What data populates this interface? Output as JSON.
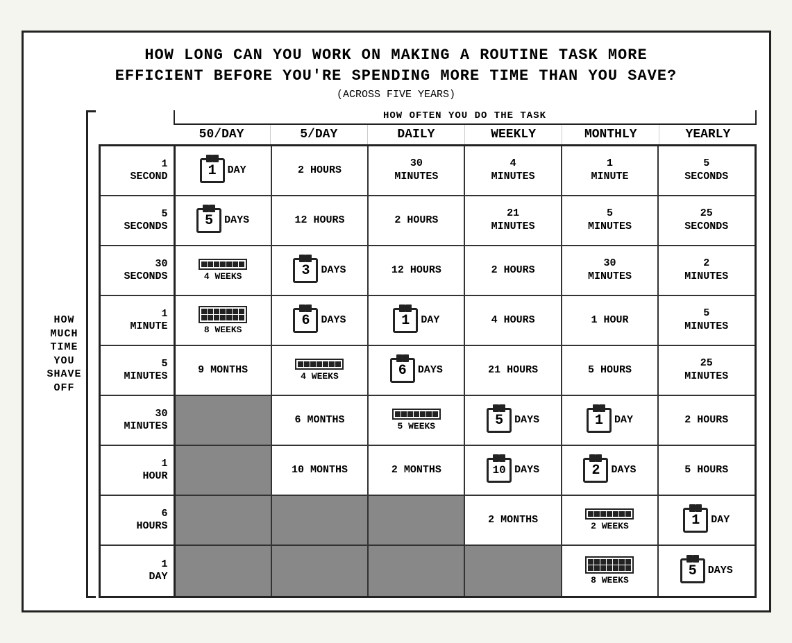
{
  "title": {
    "line1": "HOW LONG CAN YOU WORK ON MAKING A ROUTINE TASK MORE",
    "line2": "EFFICIENT BEFORE YOU'RE SPENDING MORE TIME THAN YOU SAVE?",
    "subtitle": "(ACROSS FIVE YEARS)"
  },
  "how_often_label": "HOW OFTEN YOU DO THE TASK",
  "col_labels": [
    "50/DAY",
    "5/DAY",
    "DAILY",
    "WEEKLY",
    "MONTHLY",
    "YEARLY"
  ],
  "left_label": {
    "line1": "HOW",
    "line2": "MUCH",
    "line3": "TIME",
    "line4": "YOU",
    "line5": "SHAVE",
    "line6": "OFF"
  },
  "row_headers": [
    "1 SECOND",
    "5 SECONDS",
    "30 SECONDS",
    "1 MINUTE",
    "5 MINUTES",
    "30 MINUTES",
    "1 HOUR",
    "6 HOURS",
    "1 DAY"
  ],
  "grid": [
    [
      {
        "type": "cal1",
        "val": "1",
        "unit": "DAY"
      },
      {
        "type": "text",
        "val": "2 HOURS"
      },
      {
        "type": "text",
        "val": "30\nMINUTES"
      },
      {
        "type": "text",
        "val": "4\nMINUTES"
      },
      {
        "type": "text",
        "val": "1\nMINUTE"
      },
      {
        "type": "text",
        "val": "5\nSECONDS"
      }
    ],
    [
      {
        "type": "cal1",
        "val": "5",
        "unit": "DAYS"
      },
      {
        "type": "text",
        "val": "12 HOURS"
      },
      {
        "type": "text",
        "val": "2 HOURS"
      },
      {
        "type": "text",
        "val": "21\nMINUTES"
      },
      {
        "type": "text",
        "val": "5\nMINUTES"
      },
      {
        "type": "text",
        "val": "25\nSECONDS"
      }
    ],
    [
      {
        "type": "weeks",
        "rows": 1,
        "unit": "4 WEEKS"
      },
      {
        "type": "cal1",
        "val": "3",
        "unit": "DAYS"
      },
      {
        "type": "text",
        "val": "12 HOURS"
      },
      {
        "type": "text",
        "val": "2 HOURS"
      },
      {
        "type": "text",
        "val": "30\nMINUTES"
      },
      {
        "type": "text",
        "val": "2\nMINUTES"
      }
    ],
    [
      {
        "type": "weeks",
        "rows": 2,
        "unit": "8 WEEKS"
      },
      {
        "type": "cal1",
        "val": "6",
        "unit": "DAYS"
      },
      {
        "type": "cal1",
        "val": "1",
        "unit": "DAY"
      },
      {
        "type": "text",
        "val": "4 HOURS"
      },
      {
        "type": "text",
        "val": "1 HOUR"
      },
      {
        "type": "text",
        "val": "5\nMINUTES"
      }
    ],
    [
      {
        "type": "text",
        "val": "9 MONTHS"
      },
      {
        "type": "weeks",
        "rows": 1,
        "unit": "4 WEEKS"
      },
      {
        "type": "cal1",
        "val": "6",
        "unit": "DAYS"
      },
      {
        "type": "text",
        "val": "21 HOURS"
      },
      {
        "type": "text",
        "val": "5 HOURS"
      },
      {
        "type": "text",
        "val": "25\nMINUTES"
      }
    ],
    [
      {
        "type": "dark"
      },
      {
        "type": "text",
        "val": "6 MONTHS"
      },
      {
        "type": "weeks",
        "rows": 1,
        "unit": "5 WEEKS"
      },
      {
        "type": "cal1",
        "val": "5",
        "unit": "DAYS"
      },
      {
        "type": "cal1",
        "val": "1",
        "unit": "DAY"
      },
      {
        "type": "text",
        "val": "2 HOURS"
      }
    ],
    [
      {
        "type": "dark"
      },
      {
        "type": "text",
        "val": "10 MONTHS"
      },
      {
        "type": "text",
        "val": "2 MONTHS"
      },
      {
        "type": "cal1",
        "val": "10",
        "unit": "DAYS"
      },
      {
        "type": "cal1",
        "val": "2",
        "unit": "DAYS"
      },
      {
        "type": "text",
        "val": "5 HOURS"
      }
    ],
    [
      {
        "type": "dark"
      },
      {
        "type": "dark"
      },
      {
        "type": "dark"
      },
      {
        "type": "text",
        "val": "2 MONTHS"
      },
      {
        "type": "weeks",
        "rows": 1,
        "unit": "2 WEEKS"
      },
      {
        "type": "cal1",
        "val": "1",
        "unit": "DAY"
      }
    ],
    [
      {
        "type": "dark"
      },
      {
        "type": "dark"
      },
      {
        "type": "dark"
      },
      {
        "type": "dark"
      },
      {
        "type": "weeks",
        "rows": 2,
        "unit": "8 WEEKS"
      },
      {
        "type": "cal1",
        "val": "5",
        "unit": "DAYS"
      }
    ]
  ]
}
